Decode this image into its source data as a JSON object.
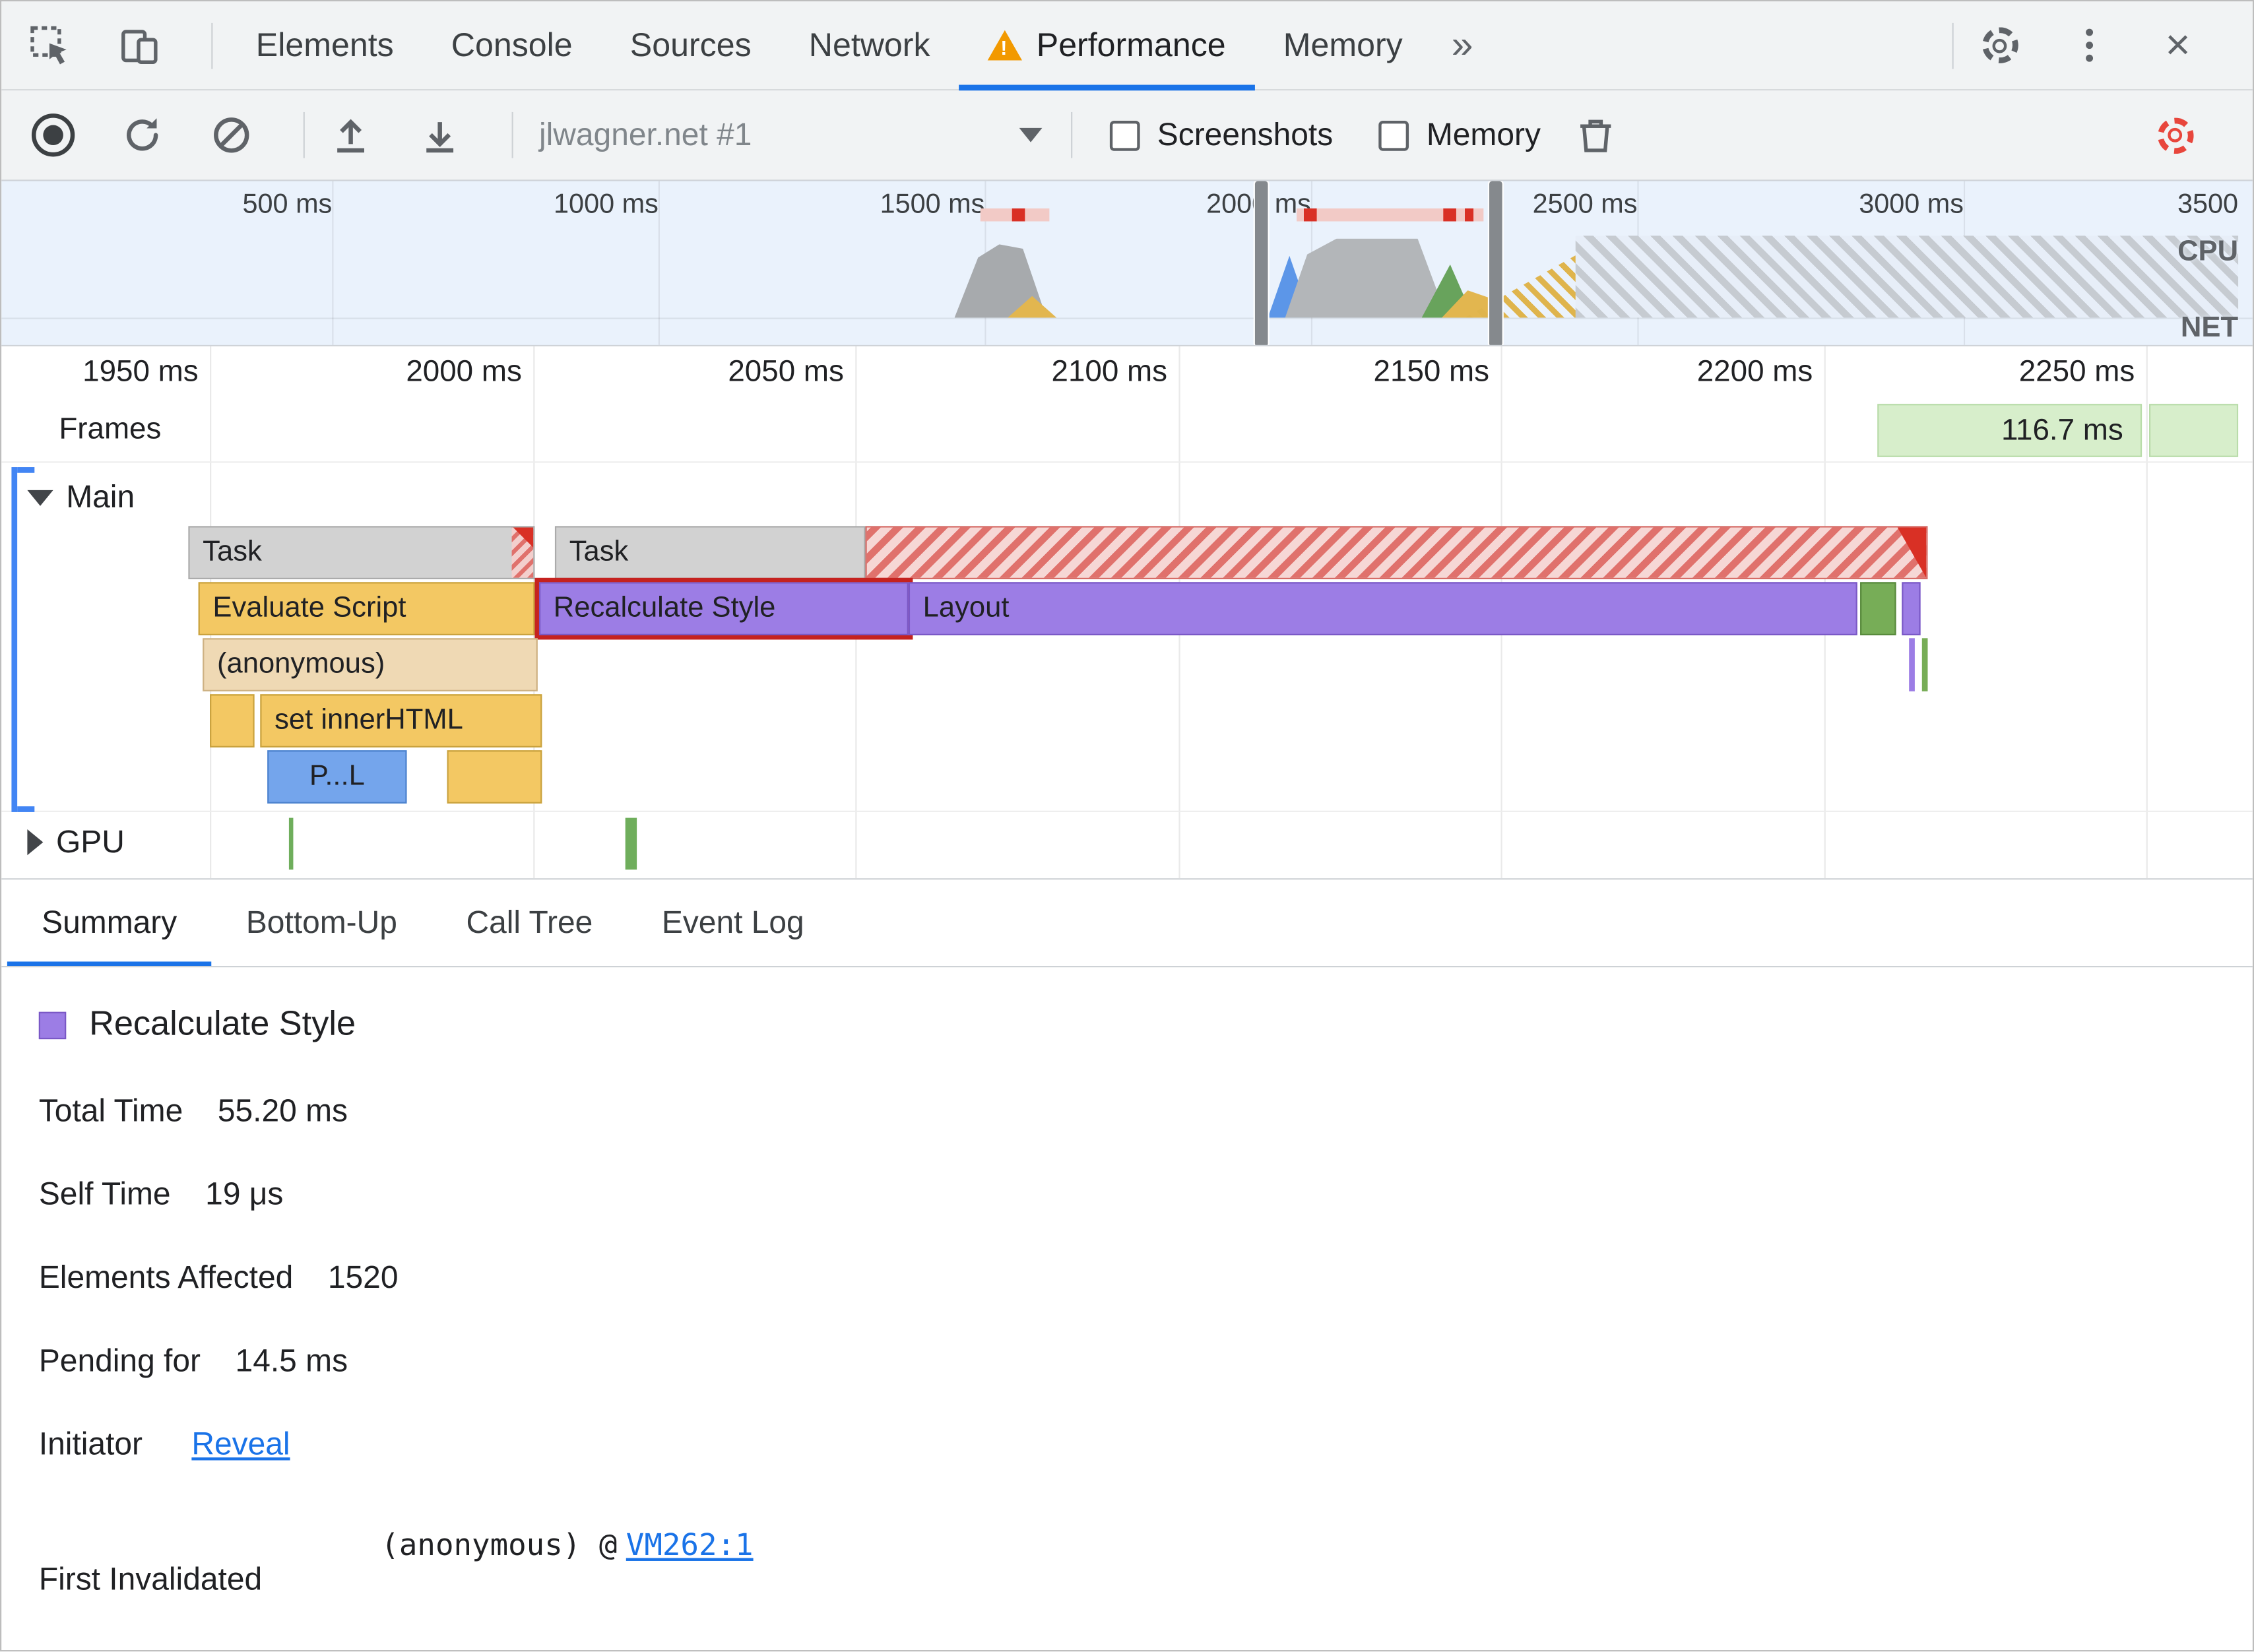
{
  "window": {
    "close": "×",
    "more_tabs": "»"
  },
  "tabs": {
    "items": [
      {
        "label": "Elements"
      },
      {
        "label": "Console"
      },
      {
        "label": "Sources"
      },
      {
        "label": "Network"
      },
      {
        "label": "Performance"
      },
      {
        "label": "Memory"
      }
    ],
    "active": "Performance"
  },
  "toolbar": {
    "session": "jlwagner.net #1",
    "screenshots_label": "Screenshots",
    "memory_label": "Memory",
    "screenshots_checked": false,
    "memory_checked": false
  },
  "overview": {
    "ticks": [
      "500 ms",
      "1000 ms",
      "1500 ms",
      "2000 ms",
      "2500 ms",
      "3000 ms",
      "3500"
    ],
    "cpu_label": "CPU",
    "net_label": "NET"
  },
  "timeline": {
    "ticks": [
      "1950 ms",
      "2000 ms",
      "2050 ms",
      "2100 ms",
      "2150 ms",
      "2200 ms",
      "2250 ms"
    ],
    "frames_label": "Frames",
    "frame_duration": "116.7 ms",
    "main_label": "Main",
    "gpu_label": "GPU",
    "bars": {
      "task": "Task",
      "evaluate_script": "Evaluate Script",
      "recalculate_style": "Recalculate Style",
      "layout": "Layout",
      "anonymous": "(anonymous)",
      "set_inner_html": "set innerHTML",
      "parse_truncated": "P...L"
    }
  },
  "bottom_tabs": {
    "items": [
      {
        "label": "Summary"
      },
      {
        "label": "Bottom-Up"
      },
      {
        "label": "Call Tree"
      },
      {
        "label": "Event Log"
      }
    ],
    "active": "Summary"
  },
  "summary": {
    "title": "Recalculate Style",
    "rows": [
      {
        "label": "Total Time",
        "value": "55.20 ms"
      },
      {
        "label": "Self Time",
        "value": "19 μs"
      },
      {
        "label": "Elements Affected",
        "value": "1520"
      },
      {
        "label": "Pending for",
        "value": "14.5 ms"
      }
    ],
    "initiator_label": "Initiator",
    "initiator_link": "Reveal",
    "first_invalidated_label": "First Invalidated",
    "first_invalidated_code": "(anonymous) @",
    "first_invalidated_link": "VM262:1"
  },
  "colors": {
    "accent_blue": "#1a73e8",
    "warning_orange": "#f29900",
    "capture_settings_red": "#e8463c",
    "bar_purple": "#9c7de5",
    "bar_yellow": "#f3c863",
    "bar_gray": "#d2d2d2",
    "bar_tan": "#efd9b4",
    "bar_blue": "#74a5ec",
    "bar_green": "#77ad57",
    "frame_green": "#d7eecb",
    "highlight_red": "#c5221f",
    "longtask_red": "#d93025"
  }
}
